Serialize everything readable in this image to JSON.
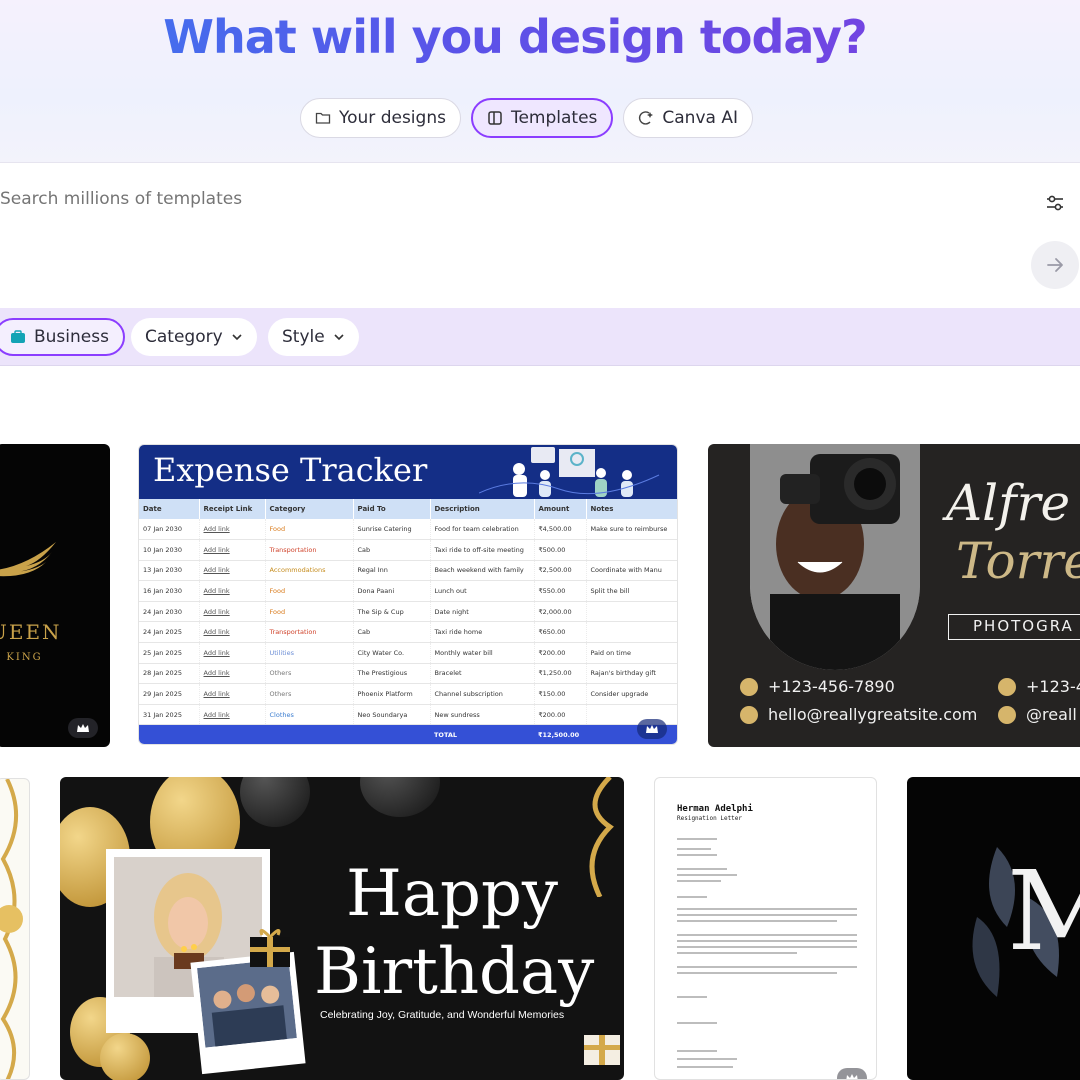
{
  "hero": {
    "title": "What will you design today?"
  },
  "tabs": [
    {
      "label": "Your designs",
      "icon": "folder-icon"
    },
    {
      "label": "Templates",
      "icon": "template-icon",
      "active": true
    },
    {
      "label": "Canva AI",
      "icon": "sparkle-icon"
    }
  ],
  "search": {
    "placeholder": "Search millions of templates"
  },
  "chips": {
    "business": "Business",
    "category": "Category",
    "style": "Style"
  },
  "cards": {
    "queen": {
      "line1": "UEEN",
      "line2": "A KING"
    },
    "expense": {
      "title": "Expense Tracker",
      "headers": [
        "Date",
        "Receipt Link",
        "Category",
        "Paid To",
        "Description",
        "Amount",
        "Notes"
      ],
      "rows": [
        [
          "07 Jan 2030",
          "Add link",
          "Food",
          "Sunrise Catering",
          "Food for team celebration",
          "₹4,500.00",
          "Make sure to reimburse"
        ],
        [
          "10 Jan 2030",
          "Add link",
          "Transportation",
          "Cab",
          "Taxi ride to off-site meeting",
          "₹500.00",
          ""
        ],
        [
          "13 Jan 2030",
          "Add link",
          "Accommodations",
          "Regal Inn",
          "Beach weekend with family",
          "₹2,500.00",
          "Coordinate with Manu"
        ],
        [
          "16 Jan 2030",
          "Add link",
          "Food",
          "Dona Paani",
          "Lunch out",
          "₹550.00",
          "Split the bill"
        ],
        [
          "24 Jan 2030",
          "Add link",
          "Food",
          "The Sip & Cup",
          "Date night",
          "₹2,000.00",
          ""
        ],
        [
          "24 Jan 2025",
          "Add link",
          "Transportation",
          "Cab",
          "Taxi ride home",
          "₹650.00",
          ""
        ],
        [
          "25 Jan 2025",
          "Add link",
          "Utilities",
          "City Water Co.",
          "Monthly water bill",
          "₹200.00",
          "Paid on time"
        ],
        [
          "28 Jan 2025",
          "Add link",
          "Others",
          "The Prestigious",
          "Bracelet",
          "₹1,250.00",
          "Rajan's birthday gift"
        ],
        [
          "29 Jan 2025",
          "Add link",
          "Others",
          "Phoenix Platform",
          "Channel subscription",
          "₹150.00",
          "Consider upgrade"
        ],
        [
          "31 Jan 2025",
          "Add link",
          "Clothes",
          "Neo Soundarya",
          "New sundress",
          "₹200.00",
          ""
        ]
      ],
      "total_label": "TOTAL",
      "total_value": "₹12,500.00"
    },
    "photographer": {
      "name1": "Alfre",
      "name2": "Torre",
      "title": "PHOTOGRA",
      "phone": "+123-456-7890",
      "email": "hello@reallygreatsite.com",
      "phone2": "+123-4",
      "web2": "@reall"
    },
    "birthday": {
      "line1": "Happy",
      "line2": "Birthday",
      "subtitle": "Celebrating Joy, Gratitude, and Wonderful Memories"
    },
    "resignation": {
      "name": "Herman Adelphi",
      "subtitle": "Resignation Letter"
    }
  },
  "colors": {
    "accent": "#8b3dff",
    "expense_header": "#142e86",
    "total_bar": "#3450d6"
  }
}
